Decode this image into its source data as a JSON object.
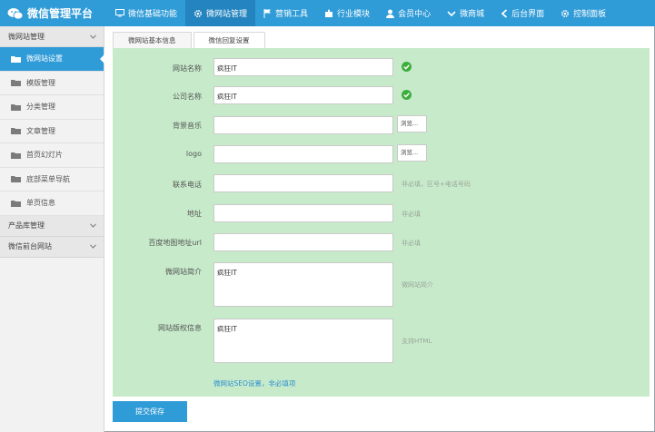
{
  "brand": {
    "title": "微信管理平台"
  },
  "nav": [
    {
      "label": "微信基础功能",
      "icon": "monitor-icon"
    },
    {
      "label": "微网站管理",
      "icon": "gear-icon",
      "active": true
    },
    {
      "label": "营销工具",
      "icon": "flag-icon"
    },
    {
      "label": "行业模块",
      "icon": "puzzle-icon"
    },
    {
      "label": "会员中心",
      "icon": "user-icon"
    },
    {
      "label": "微商城",
      "icon": "chevron-down-icon"
    },
    {
      "label": "后台界面",
      "icon": "arrow-left-icon"
    },
    {
      "label": "控制面板",
      "icon": "gear-icon"
    }
  ],
  "sidebar": {
    "group1": "微网站管理",
    "items": [
      "微网站设置",
      "模版管理",
      "分类管理",
      "文章管理",
      "首页幻灯片",
      "底部菜单导航",
      "单页信息"
    ],
    "group2": "产品库管理",
    "group3": "微信前台网站"
  },
  "tabs": [
    "微网站基本信息",
    "微信回复设置"
  ],
  "form": {
    "site_name_label": "网站名称",
    "site_name_value": "疯狂IT",
    "company_label": "公司名称",
    "company_value": "疯狂IT",
    "music_label": "背景音乐",
    "logo_label": "logo",
    "browse_label": "浏览...",
    "phone_label": "联系电话",
    "phone_hint": "非必填，区号+电话号码",
    "address_label": "地址",
    "address_hint": "非必填",
    "map_label": "百度地图地址url",
    "map_hint": "非必填",
    "intro_label": "微网站简介",
    "intro_value": "疯狂IT",
    "intro_hint": "微网站简介",
    "copyright_label": "网站版权信息",
    "copyright_value": "疯狂IT",
    "copyright_hint": "支持HTML",
    "seo_link": "微网站SEO设置，非必填项",
    "submit_label": "提交保存"
  },
  "colors": {
    "primary": "#2f9bd7",
    "panel": "#c7ebca",
    "ok": "#3cae3c"
  }
}
